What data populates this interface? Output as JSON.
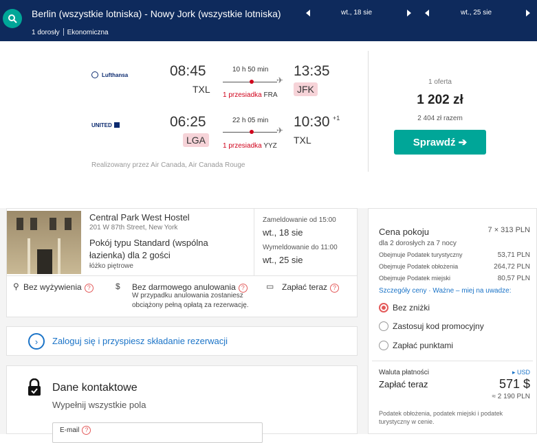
{
  "topbar": {
    "route": "Berlin (wszystkie lotniska) - Nowy Jork (wszystkie lotniska)",
    "passengers": "1 dorosły",
    "cabin": "Ekonomiczna",
    "depart_date": "wt., 18 sie",
    "return_date": "wt., 25 sie"
  },
  "flight": {
    "outbound": {
      "airline": "Lufthansa",
      "dep_time": "08:45",
      "dep_airport": "TXL",
      "arr_time": "13:35",
      "arr_airport": "JFK",
      "duration": "10 h 50 min",
      "stops": "1 przesiadka",
      "via": "FRA"
    },
    "inbound": {
      "airline": "UNITED",
      "dep_time": "06:25",
      "dep_airport": "LGA",
      "arr_time": "10:30",
      "arr_day_offset": "+1",
      "arr_airport": "TXL",
      "duration": "22 h 05 min",
      "stops": "1 przesiadka",
      "via": "YYZ"
    },
    "operated_by": "Realizowany przez Air Canada, Air Canada Rouge",
    "offers": "1 oferta",
    "price": "1 202 zł",
    "total": "2 404 zł razem",
    "check_label": "Sprawdź ➔"
  },
  "hotel": {
    "name": "Central Park West Hostel",
    "address": "201 W 87th Street, New York",
    "room_type": "Pokój typu Standard (wspólna łazienka) dla 2 gości",
    "bed": "łóżko piętrowe",
    "checkin_label": "Zameldowanie od 15:00",
    "checkin_date": "wt., 18 sie",
    "checkout_label": "Wymeldowanie do 11:00",
    "checkout_date": "wt., 25 sie",
    "meal": "Bez wyżywienia",
    "cancellation": "Bez darmowego anulowania",
    "cancellation_note": "W przypadku anulowania zostaniesz obciążony pełną opłatą za rezerwację.",
    "pay": "Zapłać teraz"
  },
  "login": {
    "text": "Zaloguj się i przyspiesz składanie rezerwacji"
  },
  "contact": {
    "title": "Dane kontaktowe",
    "subtitle": "Wypełnij wszystkie pola",
    "email_label": "E-mail"
  },
  "pricing": {
    "room_price_label": "Cena pokoju",
    "room_price_value": "7 × 313 PLN",
    "guests_nights": "dla 2 dorosłych  za 7 nocy",
    "tax_lines": [
      {
        "label": "Obejmuje Podatek turystyczny",
        "value": "53,71 PLN"
      },
      {
        "label": "Obejmuje Podatek obłożenia",
        "value": "264,72 PLN"
      },
      {
        "label": "Obejmuje Podatek miejski",
        "value": "80,57 PLN"
      }
    ],
    "price_details_link": "Szczegóły ceny",
    "notes_link": "Ważne – miej na uwadze:",
    "options": [
      "Bez zniżki",
      "Zastosuj kod promocyjny",
      "Zapłać punktami"
    ],
    "selected_option": "Bez zniżki",
    "currency_label": "Waluta płatności",
    "currency_value": "▸ USD",
    "pay_now_label": "Zapłać teraz",
    "pay_now_value": "571 $",
    "pay_now_pln": "≈ 2 190 PLN",
    "tax_note": "Podatek obłożenia, podatek miejski i podatek turystyczny w cenie.",
    "accent_color": "#e35a5a"
  },
  "colors": {
    "navy": "#0e2a5c",
    "teal": "#00a698",
    "link_blue": "#1a73c7",
    "stop_red": "#d0021b"
  }
}
